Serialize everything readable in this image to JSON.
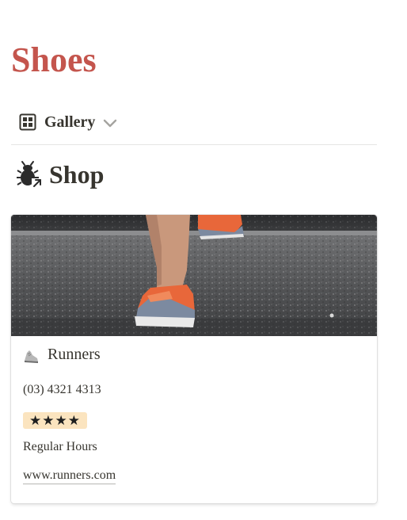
{
  "page": {
    "title": "Shoes",
    "title_color": "#c4554d"
  },
  "view": {
    "label": "Gallery",
    "icon": "gallery-grid-icon",
    "dropdown_icon": "chevron-down-icon"
  },
  "section": {
    "title": "Shop",
    "icon": "bug-link-icon"
  },
  "card": {
    "cover_image": "running-shoes-on-concrete-stairs",
    "icon": "running-shoe-icon",
    "title": "Runners",
    "phone": "(03) 4321 4313",
    "rating": "★★★★",
    "rating_badge_color": "#fbe4bf",
    "hours": "Regular Hours",
    "website": "www.runners.com"
  }
}
